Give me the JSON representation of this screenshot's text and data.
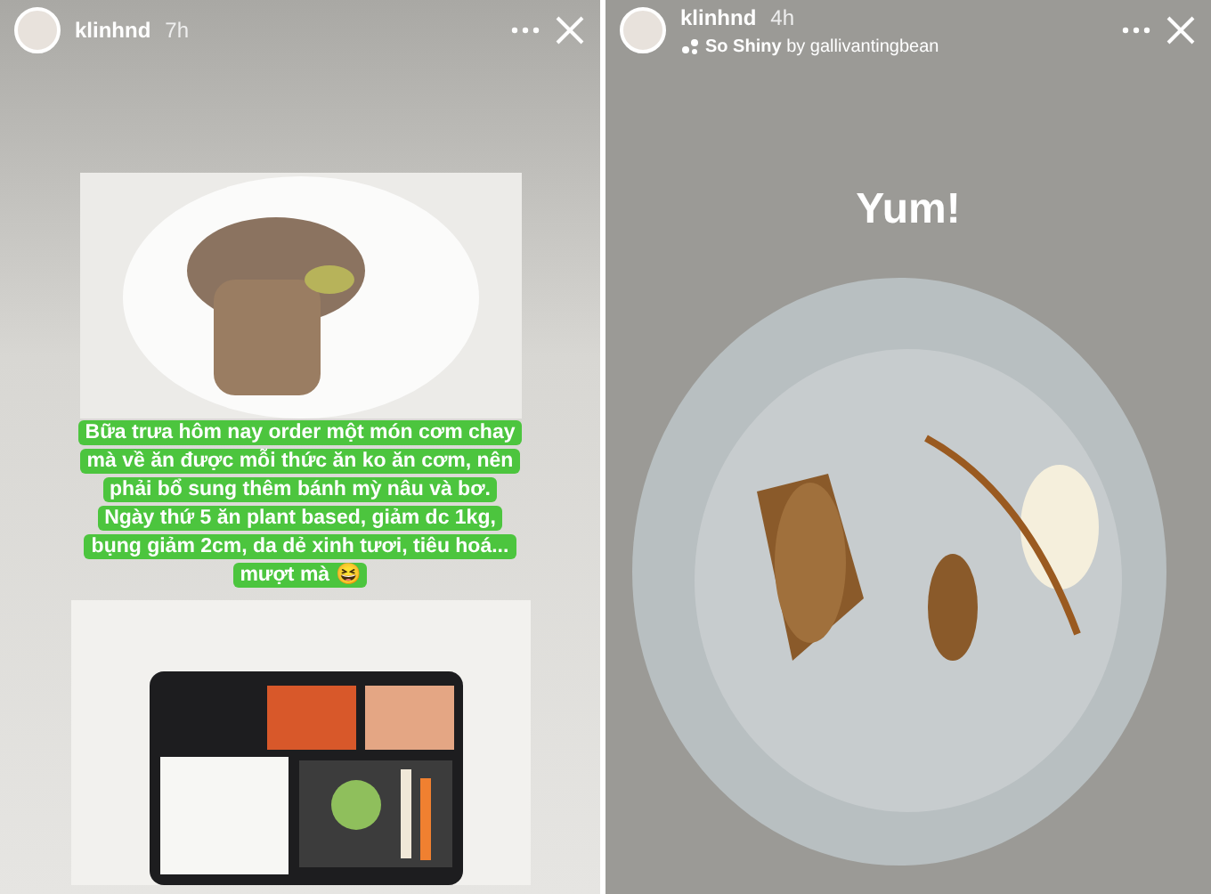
{
  "stories": [
    {
      "kind": "photo-caption",
      "username": "klinhnd",
      "time": "7h",
      "caption": [
        "Bữa trưa hôm nay order một món cơm chay mà về ăn được mỗi thức ăn ko ăn cơm, nên phải bổ sung thêm bánh mỳ nâu và bơ.",
        "Ngày thứ 5 ăn plant based, giảm dc 1kg, bụng giảm 2cm, da dẻ xinh tươi, tiêu hoá... mượt mà 😆"
      ]
    },
    {
      "kind": "photo-sticker",
      "username": "klinhnd",
      "time": "4h",
      "music": "**So Shiny** by gallivantingbean",
      "sticker": "Yum!"
    }
  ]
}
